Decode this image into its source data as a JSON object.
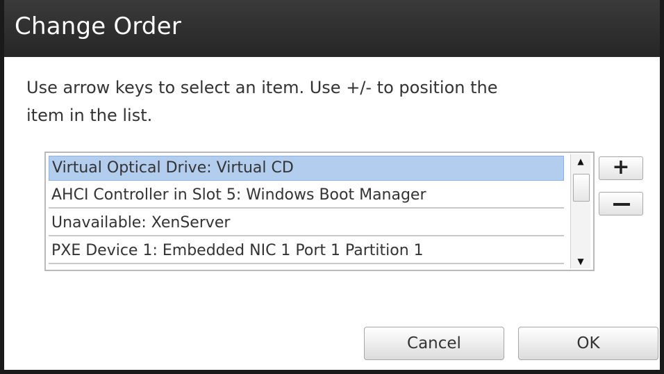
{
  "dialog": {
    "title": "Change Order",
    "instructions": "Use arrow keys to select an item. Use +/- to position the item in the list."
  },
  "list": {
    "items": [
      {
        "label": "Virtual Optical Drive: Virtual CD",
        "selected": true
      },
      {
        "label": "AHCI Controller in Slot 5: Windows Boot Manager",
        "selected": false
      },
      {
        "label": "Unavailable: XenServer",
        "selected": false
      },
      {
        "label": "PXE Device 1: Embedded NIC 1 Port 1 Partition 1",
        "selected": false
      }
    ],
    "scroll_up_icon": "triangle-up-icon",
    "scroll_down_icon": "triangle-down-icon"
  },
  "controls": {
    "plus_label": "+",
    "minus_icon": "minus-icon"
  },
  "buttons": {
    "cancel": "Cancel",
    "ok": "OK"
  },
  "colors": {
    "titlebar": "#2e2e2e",
    "selection": "#b3cdef"
  }
}
